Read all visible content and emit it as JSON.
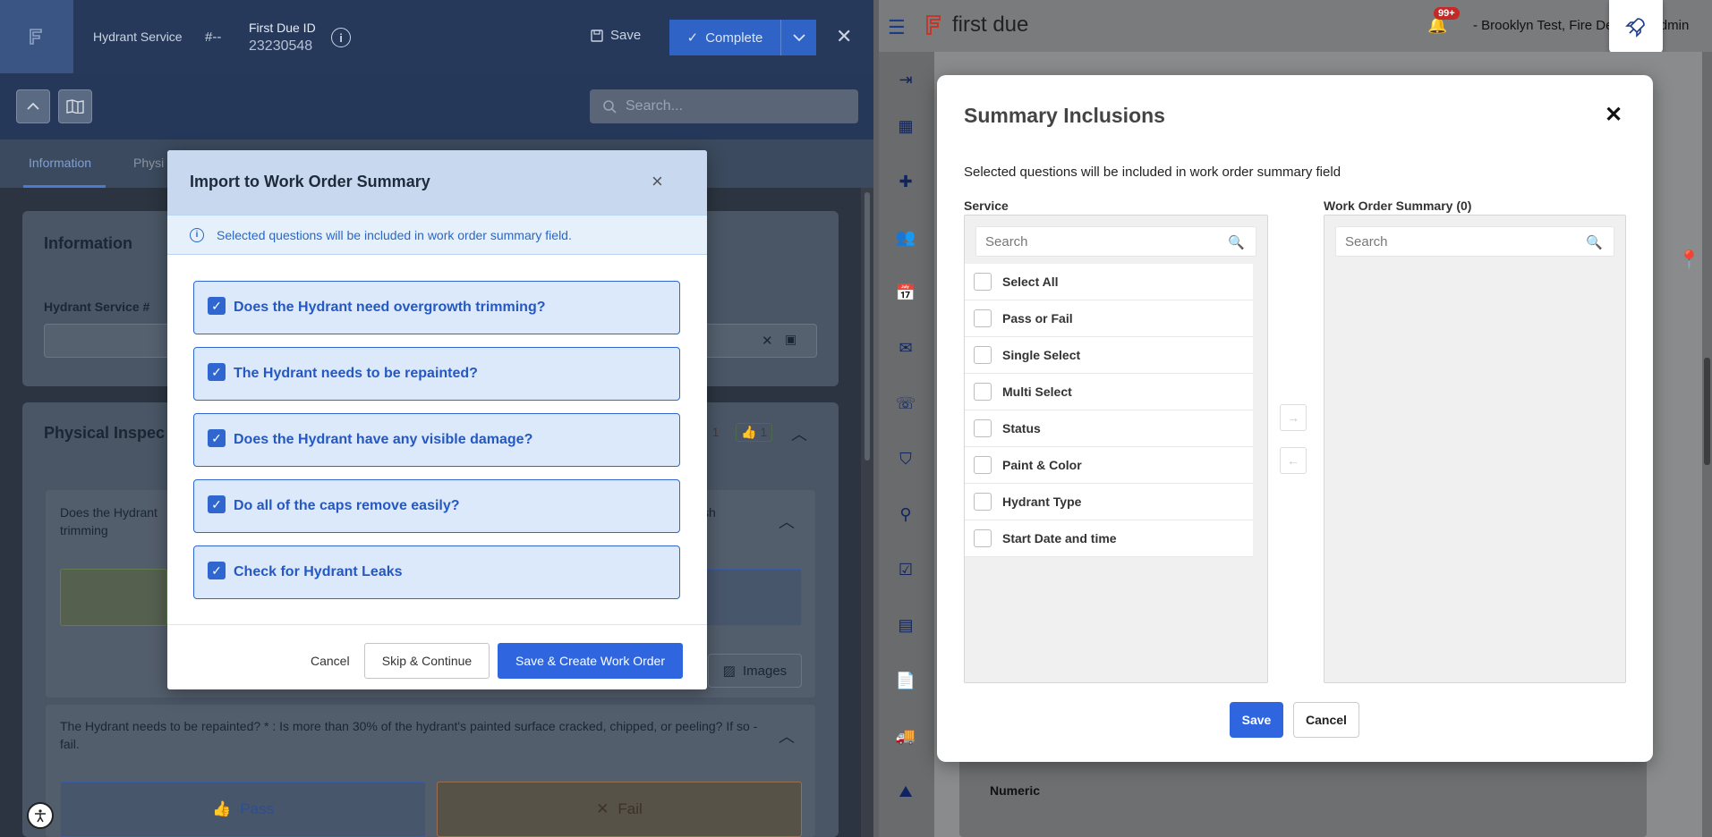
{
  "left_pane": {
    "header": {
      "title": "Hydrant Service",
      "number": "#--",
      "first_due_label": "First Due ID",
      "first_due_value": "23230548",
      "save_label": "Save",
      "complete_label": "Complete"
    },
    "search": {
      "placeholder": "Search..."
    },
    "tabs": [
      "Information",
      "Physi"
    ],
    "information": {
      "heading": "Information",
      "field_label": "Hydrant Service #"
    },
    "physical": {
      "heading": "Physical Inspec",
      "fail_count": "1",
      "pass_count": "1",
      "q1_text": "Does the Hydrant trimming",
      "q1_tail": "sh",
      "images_label": "Images",
      "q2_text": "The Hydrant needs to be repainted? * : Is more than 30% of the hydrant's painted surface cracked, chipped, or peeling? If so - fail.",
      "pass_label": "Pass",
      "fail_label": "Fail"
    }
  },
  "import_modal": {
    "title": "Import to Work Order Summary",
    "info": "Selected questions will be included in work order summary field.",
    "items": [
      "Does the Hydrant need overgrowth trimming?",
      "The Hydrant needs to be repainted?",
      "Does the Hydrant have any visible damage?",
      "Do all of the caps remove easily?",
      "Check for Hydrant Leaks"
    ],
    "cancel_label": "Cancel",
    "skip_label": "Skip & Continue",
    "save_label": "Save & Create Work Order"
  },
  "right_pane": {
    "brand": "first due",
    "notifications_badge": "99+",
    "user": "- Brooklyn Test, Fire Dep",
    "user_tail": "Admin",
    "numeric_label": "Numeric"
  },
  "summary_modal": {
    "title": "Summary Inclusions",
    "description": "Selected questions will be included in work order summary field",
    "service_label": "Service",
    "work_order_label": "Work Order Summary (0)",
    "search_placeholder": "Search",
    "service_items": [
      "Select All",
      "Pass or Fail",
      "Single Select",
      "Multi Select",
      "Status",
      "Paint & Color",
      "Hydrant Type",
      "Start Date and time"
    ],
    "save_label": "Save",
    "cancel_label": "Cancel"
  },
  "colors": {
    "primary_blue": "#2f66e0",
    "header_navy": "#26395a",
    "selected_item_bg": "#dce9fb",
    "badge_red": "#c62828"
  }
}
